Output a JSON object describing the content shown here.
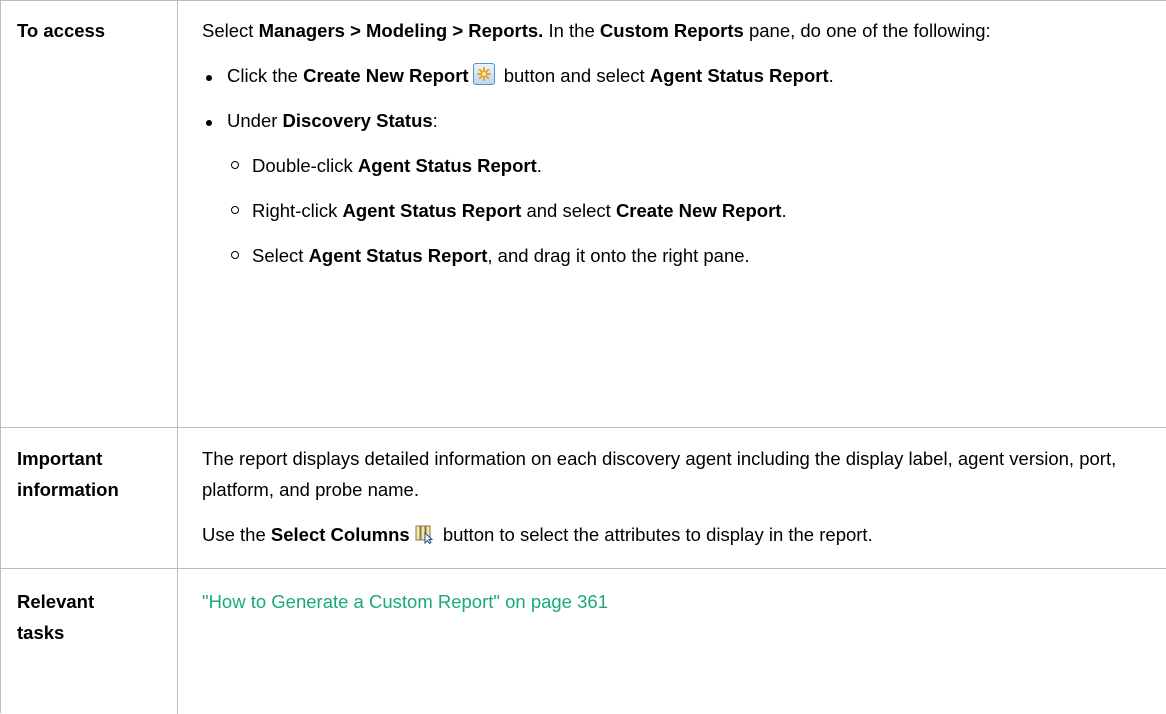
{
  "access": {
    "label": "To access",
    "intro": {
      "t1": "Select ",
      "b1": "Managers > Modeling > Reports.",
      "t2": " In the ",
      "b2": "Custom Reports",
      "t3": " pane, do one of the following:"
    },
    "bullet1": {
      "t1": "Click the ",
      "b1": "Create New Report",
      "icon": "create-new-report-icon",
      "t2": " button and select ",
      "b2": "Agent Status Report",
      "t3": "."
    },
    "bullet2": {
      "t1": "Under ",
      "b1": "Discovery Status",
      "t2": ":",
      "sub1": {
        "t1": "Double-click ",
        "b1": "Agent Status Report",
        "t2": "."
      },
      "sub2": {
        "t1": "Right-click ",
        "b1": "Agent Status Report",
        "t2": " and select ",
        "b2": "Create New Report",
        "t3": "."
      },
      "sub3": {
        "t1": "Select ",
        "b1": "Agent Status Report",
        "t2": ", and drag it onto the right pane."
      }
    }
  },
  "info": {
    "label1": "Important",
    "label2": "information",
    "para1": "The report displays detailed information on each discovery agent including the display label, agent version, port, platform, and probe name.",
    "para2": {
      "t1": "Use the ",
      "b1": "Select Columns",
      "icon": "select-columns-icon",
      "t2": " button to select the attributes to display in the report."
    }
  },
  "tasks": {
    "label1": "Relevant",
    "label2": "tasks",
    "link": "\"How to Generate a Custom Report\" on page 361",
    "link_color": "#19a97b"
  }
}
